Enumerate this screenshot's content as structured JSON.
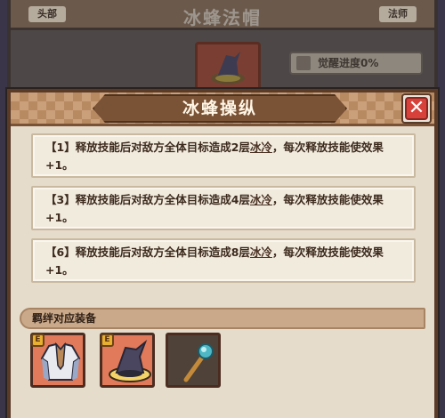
{
  "background": {
    "slot_label": "头部",
    "job_label": "法师",
    "item_title": "冰蜂法帽",
    "awaken_progress": "觉醒进度0%"
  },
  "modal": {
    "title": "冰蜂操纵",
    "close_icon": "close-x",
    "effects": [
      {
        "line1_prefix": "【1】释放技能后对敌方全体目标造成2层",
        "keyword": "冰冷",
        "line1_suffix": "，每次释放技能使效果",
        "line2": "+1。"
      },
      {
        "line1_prefix": "【3】释放技能后对敌方全体目标造成4层",
        "keyword": "冰冷",
        "line1_suffix": "，每次释放技能使效果",
        "line2": "+1。"
      },
      {
        "line1_prefix": "【6】释放技能后对敌方全体目标造成8层",
        "keyword": "冰冷",
        "line1_suffix": "，每次释放技能使效果",
        "line2": "+1。"
      }
    ],
    "equip_header": "羁绊对应装备",
    "equipment": [
      {
        "name": "robe",
        "icon": "robe-icon",
        "badge": "E",
        "bg": "#e07a5a"
      },
      {
        "name": "wizard-hat",
        "icon": "wizard-hat-icon",
        "badge": "E",
        "bg": "#e07a5a"
      },
      {
        "name": "staff",
        "icon": "staff-icon",
        "badge": "",
        "bg": "#4f4238"
      }
    ]
  }
}
